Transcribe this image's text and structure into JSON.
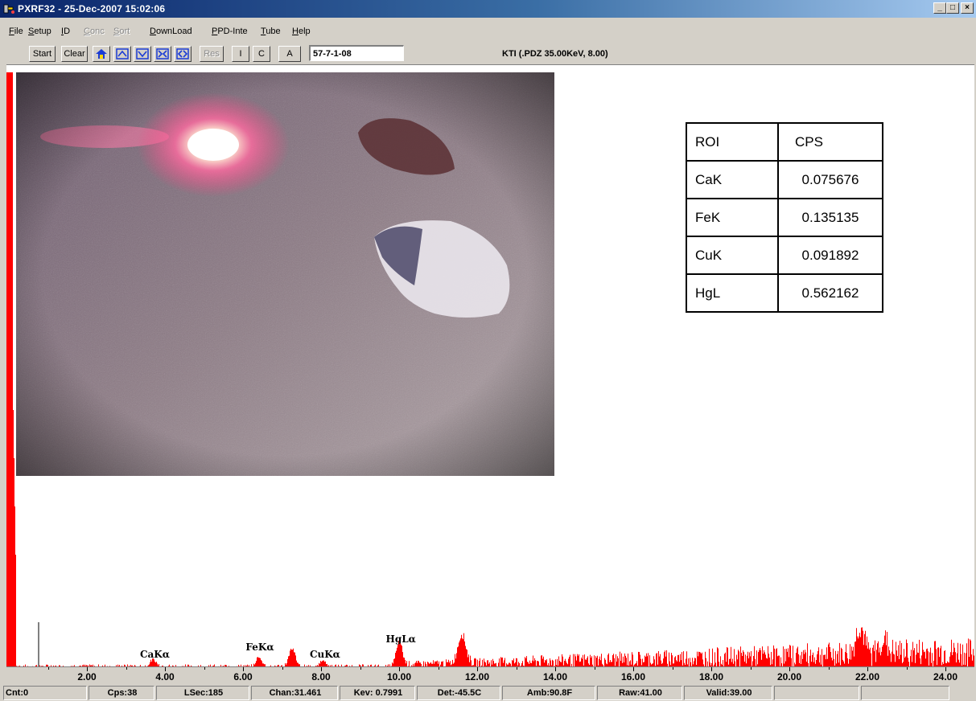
{
  "window": {
    "title": "PXRF32 - 25-Dec-2007 15:02:06",
    "minimize": "_",
    "maximize": "□",
    "close": "×"
  },
  "menu": [
    {
      "label": "File",
      "enabled": true
    },
    {
      "label": "Setup",
      "enabled": true
    },
    {
      "label": "ID",
      "enabled": true
    },
    {
      "label": "Conc",
      "enabled": false
    },
    {
      "label": "Sort",
      "enabled": false
    },
    {
      "label": "DownLoad",
      "enabled": true
    },
    {
      "label": "PPD-Inte",
      "enabled": true
    },
    {
      "label": "Tube",
      "enabled": true
    },
    {
      "label": "Help",
      "enabled": true
    }
  ],
  "toolbar": {
    "start": "Start",
    "clear": "Clear",
    "res": "Res",
    "i": "I",
    "c": "C",
    "a": "A",
    "sample_id": "57-7-1-08",
    "tube_info": "KTI  (.PDZ 35.00KeV, 8.00)"
  },
  "roi_table": {
    "headers": [
      "ROI",
      "CPS"
    ],
    "rows": [
      [
        "CaK",
        "0.075676"
      ],
      [
        "FeK",
        "0.135135"
      ],
      [
        "CuK",
        "0.091892"
      ],
      [
        "HgL",
        "0.562162"
      ]
    ]
  },
  "spectrum": {
    "color": "#ff0000",
    "peak_labels": [
      {
        "text": "CaKα",
        "kev": 3.69
      },
      {
        "text": "FeKα",
        "kev": 6.4
      },
      {
        "text": "CuKα",
        "kev": 8.04
      },
      {
        "text": "HgLα",
        "kev": 9.99
      }
    ],
    "axis_ticks": [
      "2.00",
      "4.00",
      "6.00",
      "8.00",
      "10.00",
      "12.00",
      "14.00",
      "16.00",
      "18.00",
      "20.00",
      "22.00",
      "24.00"
    ]
  },
  "status": [
    "Cnt:0",
    "Cps:38",
    "LSec:185",
    "Chan:31.461",
    "Kev: 0.7991",
    "Det:-45.5C",
    "Amb:90.8F",
    "Raw:41.00",
    "Valid:39.00",
    "",
    ""
  ]
}
